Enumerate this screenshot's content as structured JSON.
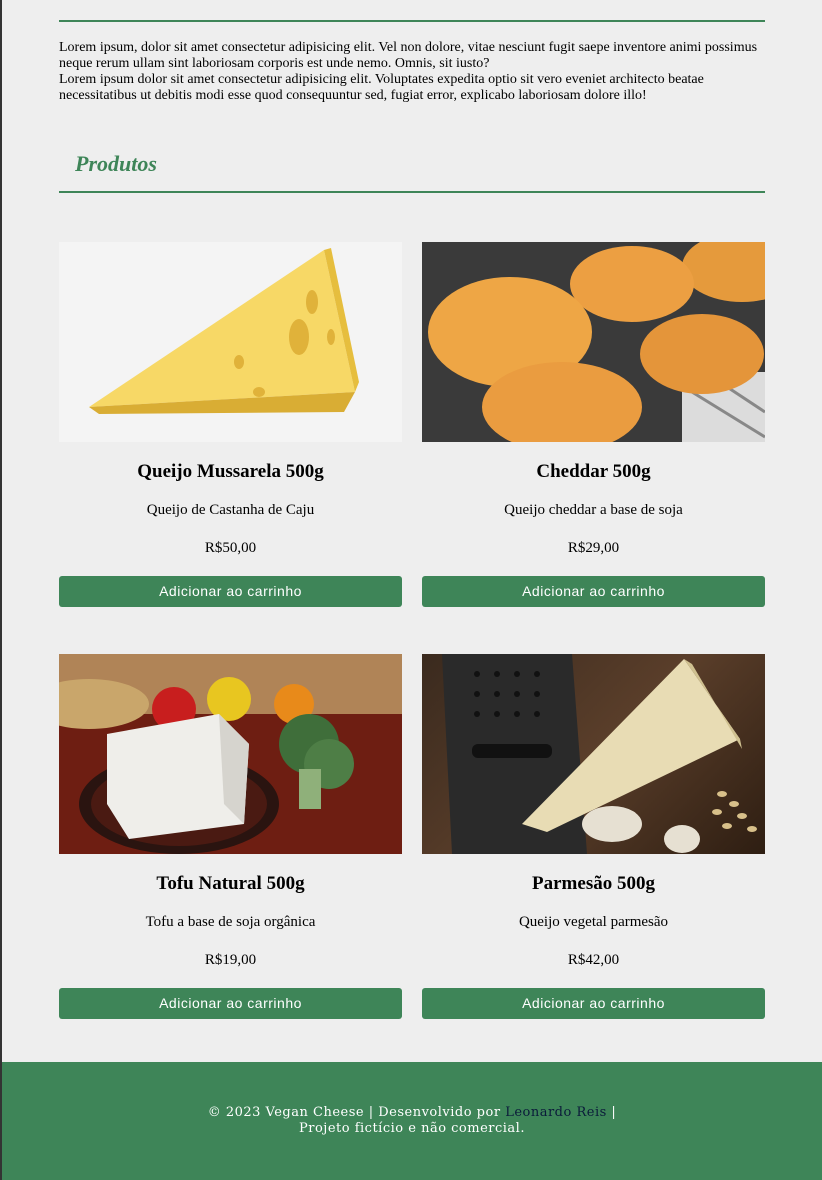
{
  "about": {
    "paragraph1": "Lorem ipsum, dolor sit amet consectetur adipisicing elit. Vel non dolore, vitae nesciunt fugit saepe inventore animi possimus neque rerum ullam sint laboriosam corporis est unde nemo. Omnis, sit iusto?",
    "paragraph2": "Lorem ipsum dolor sit amet consectetur adipisicing elit. Voluptates expedita optio sit vero eveniet architecto beatae necessitatibus ut debitis modi esse quod consequuntur sed, fugiat error, explicabo laboriosam dolore illo!"
  },
  "products": {
    "title": "Produtos",
    "items": [
      {
        "name": "Queijo Mussarela 500g",
        "description": "Queijo de Castanha de Caju",
        "price": "R$50,00",
        "button": "Adicionar ao carrinho"
      },
      {
        "name": "Cheddar 500g",
        "description": "Queijo cheddar a base de soja",
        "price": "R$29,00",
        "button": "Adicionar ao carrinho"
      },
      {
        "name": "Tofu Natural 500g",
        "description": "Tofu a base de soja orgânica",
        "price": "R$19,00",
        "button": "Adicionar ao carrinho"
      },
      {
        "name": "Parmesão 500g",
        "description": "Queijo vegetal parmesão",
        "price": "R$42,00",
        "button": "Adicionar ao carrinho"
      }
    ]
  },
  "footer": {
    "prefix": "© 2023 Vegan Cheese | Desenvolvido por ",
    "author": "Leonardo Reis",
    "suffix": " |",
    "line2": "Projeto fictício e não comercial."
  },
  "colors": {
    "accent": "#3e8558",
    "background": "#eeeeee",
    "footer_link": "#0a1a3a"
  }
}
